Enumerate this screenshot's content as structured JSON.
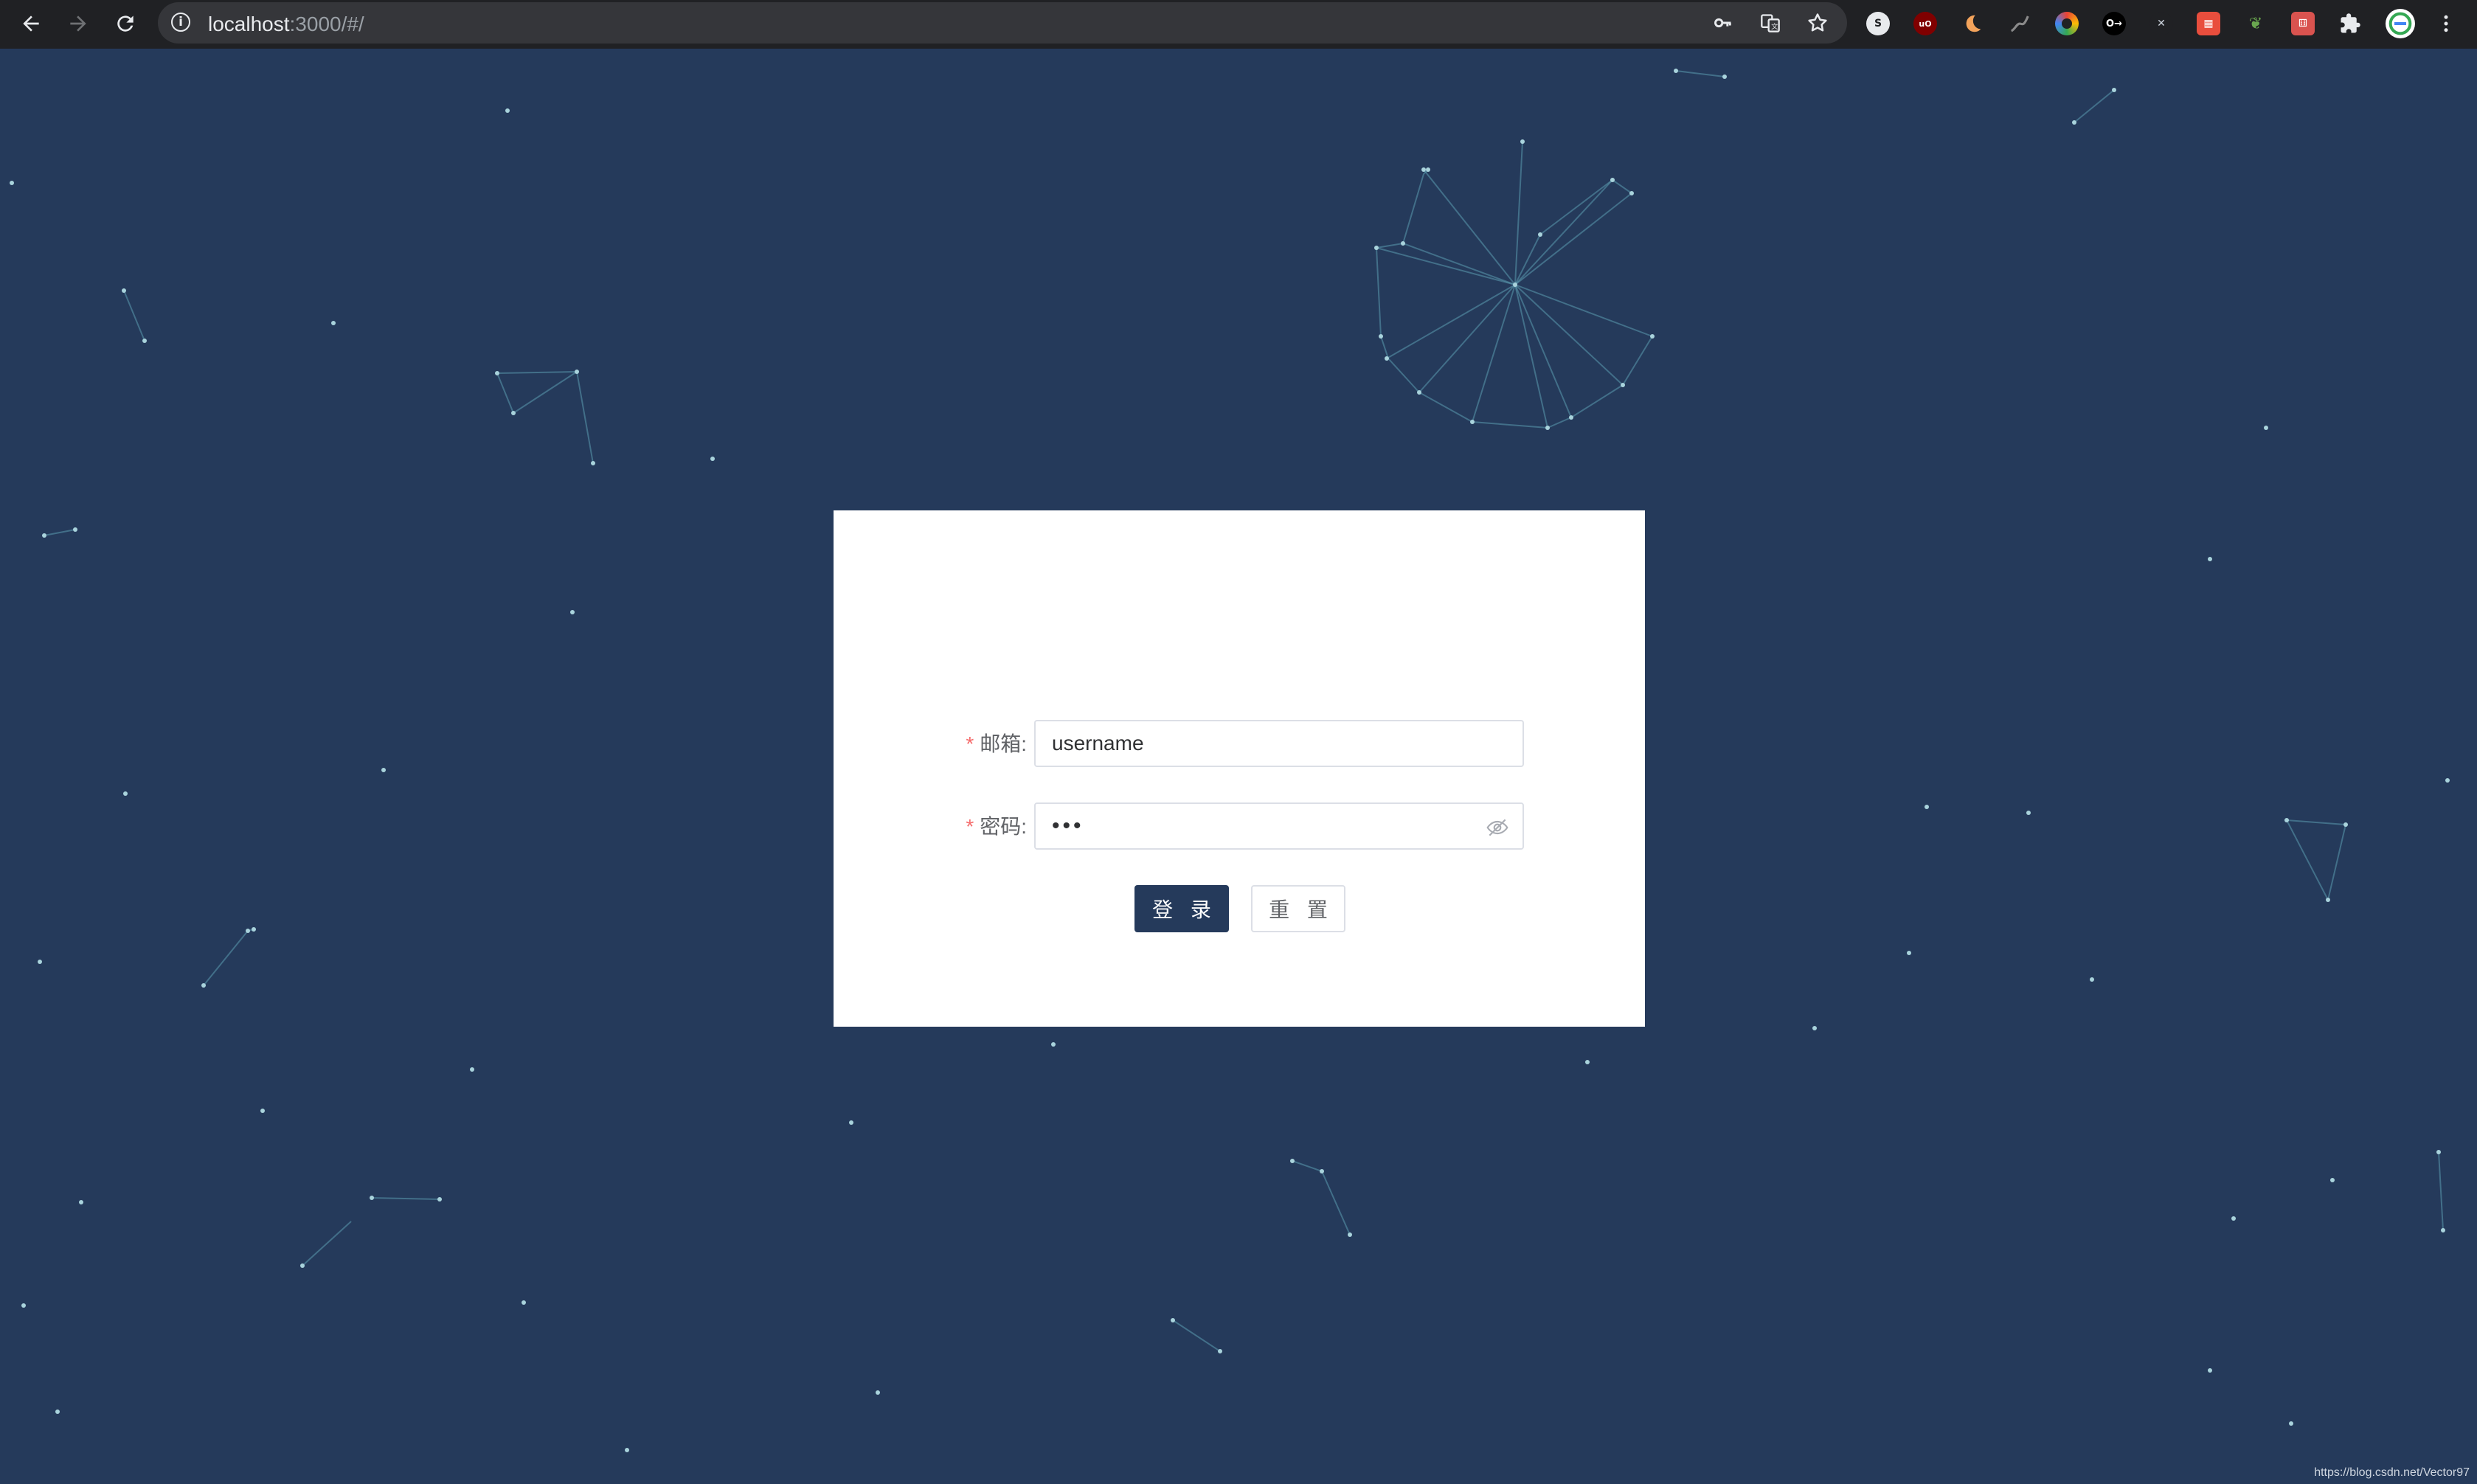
{
  "browser": {
    "url_host": "localhost",
    "url_path": ":3000/#/",
    "back_icon": "arrow-left-icon",
    "forward_icon": "arrow-right-icon",
    "reload_icon": "reload-icon",
    "site_info_icon": "info-icon",
    "extensions": [
      "password-manager",
      "google-translate",
      "bookmark-star",
      "ext-s",
      "ublock-origin",
      "dark-reader",
      "ext-route",
      "ext-ring",
      "ext-key",
      "ext-x",
      "ext-pixel",
      "ext-leaf",
      "ext-dice",
      "puzzle",
      "profile",
      "menu"
    ]
  },
  "login_form": {
    "email": {
      "required_mark": "*",
      "label": "邮箱:",
      "value": "username"
    },
    "password": {
      "required_mark": "*",
      "label": "密码:",
      "value_masked": "•••",
      "toggle_icon": "eye-off-icon"
    },
    "login_button": "登 录",
    "reset_button": "重 置"
  },
  "watermark": "https://blog.csdn.net/Vector97",
  "colors": {
    "background": "#253a5b",
    "card": "#ffffff",
    "primary_button": "#253a5b",
    "required_mark": "#f56c6c",
    "particles": "#7ab8c8"
  }
}
